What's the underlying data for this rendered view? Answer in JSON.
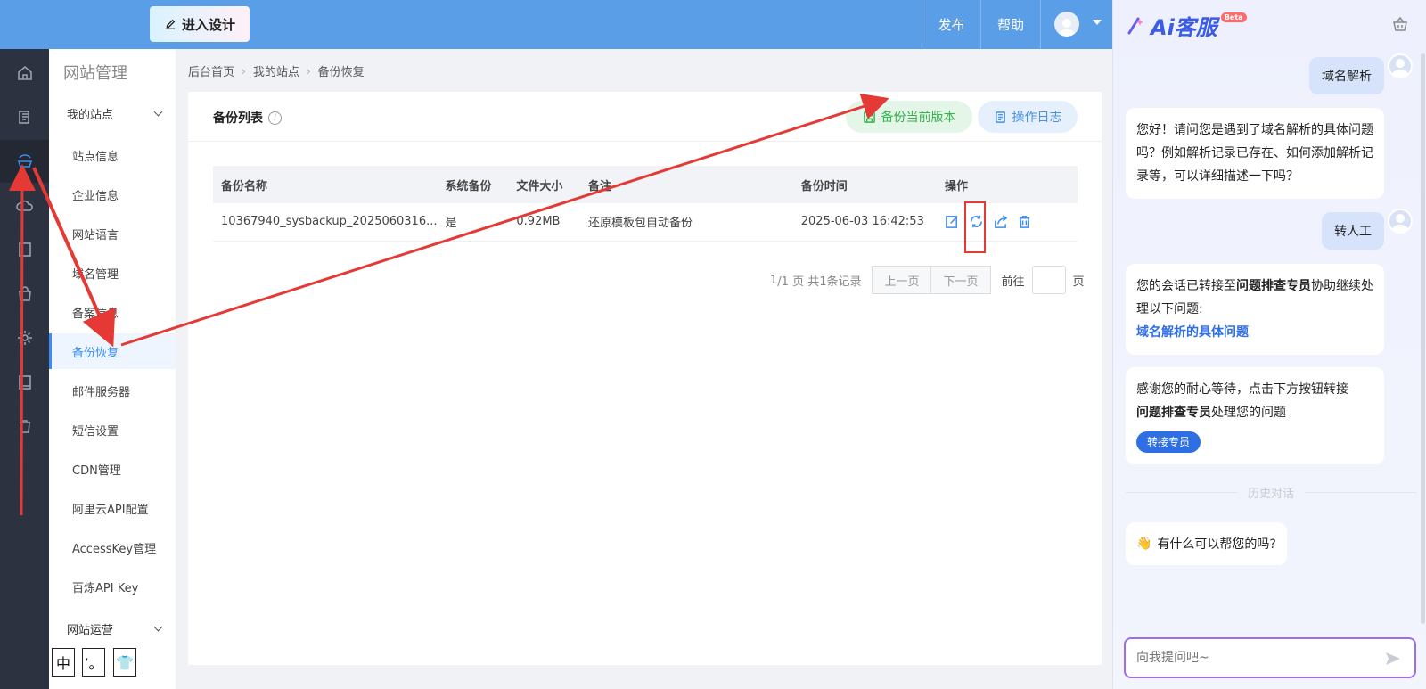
{
  "topbar": {
    "enter_design": "进入设计",
    "publish": "发布",
    "help": "帮助"
  },
  "rail_icons": [
    "home-icon",
    "pages-icon",
    "site-icon",
    "cloud-icon",
    "book-icon",
    "bag-icon",
    "settings-icon",
    "manual-icon",
    "trash-icon"
  ],
  "subnav": {
    "title": "网站管理",
    "group_my_sites": "我的站点",
    "items": [
      "站点信息",
      "企业信息",
      "网站语言",
      "域名管理",
      "备案信息",
      "备份恢复",
      "邮件服务器",
      "短信设置",
      "CDN管理",
      "阿里云API配置",
      "AccessKey管理",
      "百炼API Key"
    ],
    "group_ops": "网站运营",
    "lang_boxes": [
      "中",
      "’。",
      "👕"
    ]
  },
  "breadcrumb": [
    "后台首页",
    "我的站点",
    "备份恢复"
  ],
  "card": {
    "title": "备份列表",
    "info_glyph": "i",
    "backup_btn": "备份当前版本",
    "log_btn": "操作日志"
  },
  "table": {
    "headers": [
      "备份名称",
      "系统备份",
      "文件大小",
      "备注",
      "备份时间",
      "操作"
    ],
    "rows": [
      {
        "name": "10367940_sysbackup_2025060316...",
        "system": "是",
        "size": "0.92MB",
        "note": "还原模板包自动备份",
        "time": "2025-06-03 16:42:53"
      }
    ]
  },
  "pager": {
    "current": "1",
    "total_text": "/1 页 共1条记录",
    "prev": "上一页",
    "next": "下一页",
    "goto": "前往",
    "page_unit": "页"
  },
  "chat": {
    "brand": "Ai客服",
    "beta": "Beta",
    "user_msg_1": "域名解析",
    "bot_msg_1": "您好！请问您是遇到了域名解析的具体问题吗？例如解析记录已存在、如何添加解析记录等，可以详细描述一下吗？",
    "user_msg_2": "转人工",
    "bot_msg_2_a": "您的会话已转接至",
    "bot_msg_2_b": "问题排查专员",
    "bot_msg_2_c": "协助继续处理以下问题:",
    "bot_msg_2_link": "域名解析的具体问题",
    "bot_msg_3_a": "感谢您的耐心等待，点击下方按钮转接",
    "bot_msg_3_b": "问题排查专员",
    "bot_msg_3_c": "处理您的问题",
    "transfer_btn": "转接专员",
    "history": "历史对话",
    "hello_emoji": "👋",
    "hello": "有什么可以帮您的吗?",
    "input_placeholder": "向我提问吧~"
  },
  "colors": {
    "topbar": "#5b9ee8",
    "accent": "#3d8ef0",
    "annotation": "#e53935"
  }
}
